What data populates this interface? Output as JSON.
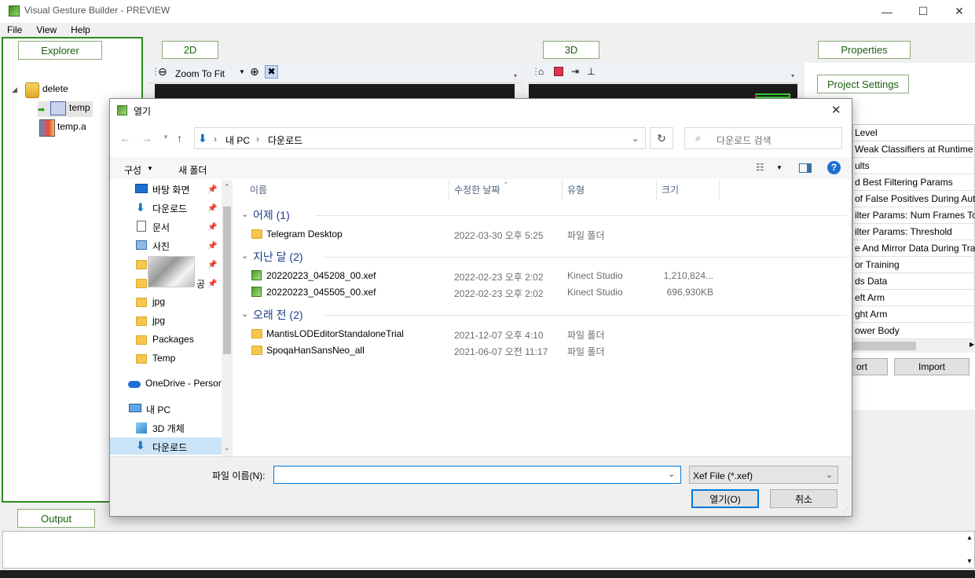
{
  "app": {
    "title": "Visual Gesture Builder - PREVIEW",
    "window_controls": {
      "minimize": "—",
      "maximize": "☐",
      "close": "✕"
    },
    "menu": [
      "File",
      "View",
      "Help"
    ]
  },
  "panels": {
    "explorer_tab": "Explorer",
    "tab_2d": "2D",
    "tab_3d": "3D",
    "properties_tab": "Properties",
    "output_tab": "Output"
  },
  "explorer_tree": {
    "root": "delete",
    "children": [
      "temp",
      "temp.a"
    ]
  },
  "view2d": {
    "zoom_label": "Zoom To Fit"
  },
  "properties": {
    "project_settings_button": "Project Settings",
    "rows": [
      "Level",
      "Weak Classifiers at Runtime",
      "ults",
      "d Best Filtering Params",
      "of False Positives During Auto",
      "ilter Params: Num Frames To",
      "ilter Params: Threshold",
      "e And Mirror Data During Trai",
      "or Training",
      "ds Data",
      "eft Arm",
      "ght Arm",
      "ower Body"
    ],
    "export_label": "ort",
    "import_label": "Import"
  },
  "dialog": {
    "title": "열기",
    "close": "✕",
    "breadcrumb": [
      "내 PC",
      "다운로드"
    ],
    "search_placeholder": "다운로드 검색",
    "organize": "구성",
    "new_folder": "새 폴더",
    "columns": {
      "name": "이름",
      "date": "수정한 날짜",
      "type": "유형",
      "size": "크기"
    },
    "nav": {
      "quick": [
        {
          "label": "바탕 화면",
          "icon": "desktop-icon",
          "pinned": true
        },
        {
          "label": "다운로드",
          "icon": "download-arrow-icon",
          "pinned": true
        },
        {
          "label": "문서",
          "icon": "document-icon",
          "pinned": true
        },
        {
          "label": "사진",
          "icon": "pictures-icon",
          "pinned": true
        },
        {
          "label": "",
          "icon": "folder-icon",
          "pinned": true
        },
        {
          "label": "공",
          "icon": "folder-icon",
          "pinned": true
        },
        {
          "label": "jpg",
          "icon": "folder-icon",
          "pinned": false
        },
        {
          "label": "jpg",
          "icon": "folder-icon",
          "pinned": false
        },
        {
          "label": "Packages",
          "icon": "folder-icon",
          "pinned": false
        },
        {
          "label": "Temp",
          "icon": "folder-icon",
          "pinned": false
        }
      ],
      "onedrive": "OneDrive - Person",
      "this_pc": "내 PC",
      "objects3d": "3D 개체",
      "downloads": "다운로드"
    },
    "groups": [
      {
        "label": "어제 (1)",
        "files": [
          {
            "name": "Telegram Desktop",
            "date": "2022-03-30 오후 5:25",
            "type": "파일 폴더",
            "size": "",
            "kind": "folder"
          }
        ]
      },
      {
        "label": "지난 달 (2)",
        "files": [
          {
            "name": "20220223_045208_00.xef",
            "date": "2022-02-23 오후 2:02",
            "type": "Kinect Studio",
            "size": "1,210,824...",
            "kind": "xef"
          },
          {
            "name": "20220223_045505_00.xef",
            "date": "2022-02-23 오후 2:02",
            "type": "Kinect Studio",
            "size": "696,930KB",
            "kind": "xef"
          }
        ]
      },
      {
        "label": "오래 전 (2)",
        "files": [
          {
            "name": "MantisLODEditorStandaloneTrial",
            "date": "2021-12-07 오후 4:10",
            "type": "파일 폴더",
            "size": "",
            "kind": "folder"
          },
          {
            "name": "SpoqaHanSansNeo_all",
            "date": "2021-06-07 오전 11:17",
            "type": "파일 폴더",
            "size": "",
            "kind": "folder"
          }
        ]
      }
    ],
    "filename_label": "파일 이름(N):",
    "filename_value": "",
    "filter": "Xef File (*.xef)",
    "open_button": "열기(O)",
    "cancel_button": "취소"
  }
}
